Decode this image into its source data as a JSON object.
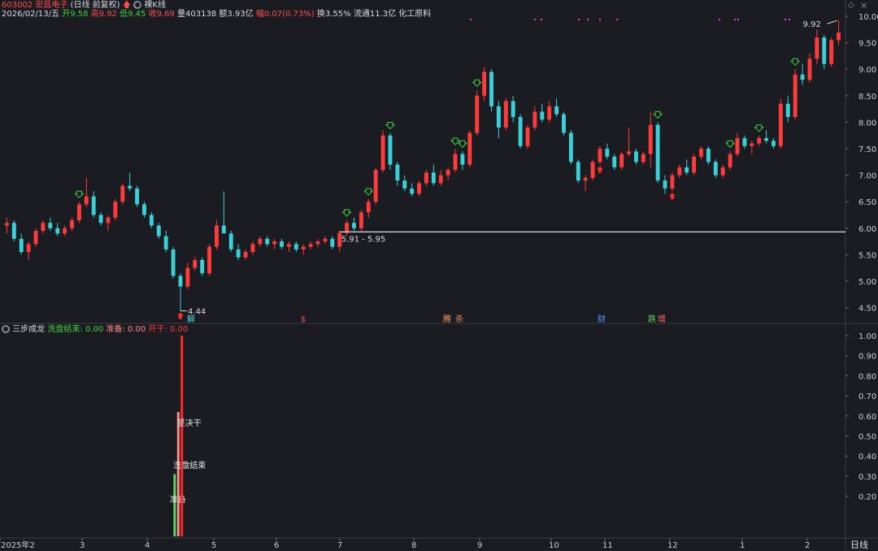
{
  "header": {
    "code": "603002",
    "name": "宏昌电子",
    "mode": "(日线 前复权)",
    "view": "裸K线",
    "date": "2026/02/13/五",
    "open_label": "开",
    "open": "9.58",
    "high_label": "高",
    "high": "9.92",
    "low_label": "低",
    "low": "9.45",
    "close_label": "收",
    "close": "9.69",
    "vol_label": "量",
    "vol": "403138",
    "amt_label": "额",
    "amt": "3.93亿",
    "chg_label": "幅",
    "chg": "0.07(0.73%)",
    "turn": "换3.55%",
    "float": "流通11.3亿",
    "industry": "化工原料"
  },
  "colors": {
    "up": "#ff3b3b",
    "down": "#39d0d8",
    "bg": "#1b1c21",
    "grid": "#2c2e35"
  },
  "chart_data": [
    {
      "type": "candlestick",
      "y_ticks": [
        "10.00",
        "9.50",
        "9.00",
        "8.50",
        "8.00",
        "7.50",
        "7.00",
        "6.50",
        "6.00",
        "5.50",
        "5.00",
        "4.50"
      ],
      "ylim": [
        4.35,
        10.1
      ],
      "x_ticks": [
        "2025年2",
        "3",
        "4",
        "5",
        "6",
        "7",
        "8",
        "9",
        "10",
        "11",
        "12",
        "1",
        "2"
      ],
      "annotations": {
        "low": "4.44",
        "high": "9.92",
        "zone": "5.91 - 5.95",
        "zone_price": 5.93
      },
      "bottom_tags": [
        {
          "text": "解",
          "color": "#52d7df",
          "x": 230
        },
        {
          "text": "$",
          "color": "#ff4d4f",
          "x": 370
        },
        {
          "text": "腾",
          "color": "#ff9a6a",
          "x": 545
        },
        {
          "text": "杀",
          "color": "#ff9a6a",
          "x": 560
        },
        {
          "text": "财",
          "color": "#52a0ff",
          "x": 735
        },
        {
          "text": "跌",
          "color": "#5cd65c",
          "x": 797
        },
        {
          "text": "增",
          "color": "#ff6b6b",
          "x": 809
        }
      ],
      "candles": [
        {
          "o": 6.05,
          "h": 6.2,
          "l": 5.9,
          "c": 6.1
        },
        {
          "o": 6.1,
          "h": 6.15,
          "l": 5.75,
          "c": 5.8
        },
        {
          "o": 5.8,
          "h": 5.9,
          "l": 5.5,
          "c": 5.55
        },
        {
          "o": 5.55,
          "h": 5.75,
          "l": 5.4,
          "c": 5.7
        },
        {
          "o": 5.7,
          "h": 6.0,
          "l": 5.65,
          "c": 5.95
        },
        {
          "o": 5.95,
          "h": 6.15,
          "l": 5.9,
          "c": 6.1
        },
        {
          "o": 6.1,
          "h": 6.2,
          "l": 5.95,
          "c": 6.0
        },
        {
          "o": 6.0,
          "h": 6.1,
          "l": 5.85,
          "c": 5.9
        },
        {
          "o": 5.9,
          "h": 6.05,
          "l": 5.85,
          "c": 6.0
        },
        {
          "o": 6.0,
          "h": 6.2,
          "l": 5.95,
          "c": 6.15
        },
        {
          "o": 6.15,
          "h": 6.5,
          "l": 6.1,
          "c": 6.45
        },
        {
          "o": 6.45,
          "h": 6.95,
          "l": 6.4,
          "c": 6.6
        },
        {
          "o": 6.6,
          "h": 6.7,
          "l": 6.2,
          "c": 6.25
        },
        {
          "o": 6.25,
          "h": 6.3,
          "l": 6.05,
          "c": 6.1
        },
        {
          "o": 6.1,
          "h": 6.25,
          "l": 5.95,
          "c": 6.2
        },
        {
          "o": 6.2,
          "h": 6.55,
          "l": 6.15,
          "c": 6.5
        },
        {
          "o": 6.5,
          "h": 6.85,
          "l": 6.45,
          "c": 6.8
        },
        {
          "o": 6.8,
          "h": 7.05,
          "l": 6.7,
          "c": 6.75
        },
        {
          "o": 6.75,
          "h": 6.8,
          "l": 6.4,
          "c": 6.45
        },
        {
          "o": 6.45,
          "h": 6.5,
          "l": 6.2,
          "c": 6.25
        },
        {
          "o": 6.25,
          "h": 6.3,
          "l": 6.0,
          "c": 6.05
        },
        {
          "o": 6.05,
          "h": 6.1,
          "l": 5.8,
          "c": 5.85
        },
        {
          "o": 5.85,
          "h": 5.95,
          "l": 5.55,
          "c": 5.6
        },
        {
          "o": 5.6,
          "h": 5.65,
          "l": 5.05,
          "c": 5.1
        },
        {
          "o": 5.1,
          "h": 5.15,
          "l": 4.44,
          "c": 4.9
        },
        {
          "o": 4.9,
          "h": 5.35,
          "l": 4.85,
          "c": 5.25
        },
        {
          "o": 5.25,
          "h": 5.45,
          "l": 5.2,
          "c": 5.4
        },
        {
          "o": 5.4,
          "h": 5.45,
          "l": 5.1,
          "c": 5.15
        },
        {
          "o": 5.15,
          "h": 5.7,
          "l": 5.1,
          "c": 5.65
        },
        {
          "o": 5.65,
          "h": 6.15,
          "l": 5.6,
          "c": 6.05
        },
        {
          "o": 6.05,
          "h": 6.7,
          "l": 6.0,
          "c": 5.9
        },
        {
          "o": 5.9,
          "h": 5.95,
          "l": 5.55,
          "c": 5.6
        },
        {
          "o": 5.6,
          "h": 5.7,
          "l": 5.4,
          "c": 5.45
        },
        {
          "o": 5.45,
          "h": 5.6,
          "l": 5.4,
          "c": 5.55
        },
        {
          "o": 5.55,
          "h": 5.75,
          "l": 5.5,
          "c": 5.7
        },
        {
          "o": 5.7,
          "h": 5.85,
          "l": 5.65,
          "c": 5.8
        },
        {
          "o": 5.8,
          "h": 5.85,
          "l": 5.65,
          "c": 5.7
        },
        {
          "o": 5.7,
          "h": 5.8,
          "l": 5.6,
          "c": 5.75
        },
        {
          "o": 5.75,
          "h": 5.8,
          "l": 5.6,
          "c": 5.65
        },
        {
          "o": 5.65,
          "h": 5.75,
          "l": 5.55,
          "c": 5.7
        },
        {
          "o": 5.7,
          "h": 5.75,
          "l": 5.55,
          "c": 5.6
        },
        {
          "o": 5.6,
          "h": 5.7,
          "l": 5.5,
          "c": 5.65
        },
        {
          "o": 5.65,
          "h": 5.75,
          "l": 5.6,
          "c": 5.7
        },
        {
          "o": 5.7,
          "h": 5.8,
          "l": 5.65,
          "c": 5.75
        },
        {
          "o": 5.75,
          "h": 5.85,
          "l": 5.7,
          "c": 5.8
        },
        {
          "o": 5.8,
          "h": 5.85,
          "l": 5.6,
          "c": 5.65
        },
        {
          "o": 5.65,
          "h": 5.95,
          "l": 5.55,
          "c": 5.91
        },
        {
          "o": 5.91,
          "h": 6.15,
          "l": 5.85,
          "c": 6.1
        },
        {
          "o": 6.1,
          "h": 6.2,
          "l": 5.95,
          "c": 6.0
        },
        {
          "o": 6.0,
          "h": 6.35,
          "l": 5.95,
          "c": 6.3
        },
        {
          "o": 6.3,
          "h": 6.55,
          "l": 6.2,
          "c": 6.5
        },
        {
          "o": 6.5,
          "h": 7.15,
          "l": 6.45,
          "c": 7.1
        },
        {
          "o": 7.1,
          "h": 7.85,
          "l": 7.05,
          "c": 7.75
        },
        {
          "o": 7.75,
          "h": 7.8,
          "l": 7.1,
          "c": 7.2
        },
        {
          "o": 7.2,
          "h": 7.25,
          "l": 6.8,
          "c": 6.9
        },
        {
          "o": 6.9,
          "h": 7.0,
          "l": 6.7,
          "c": 6.75
        },
        {
          "o": 6.75,
          "h": 6.85,
          "l": 6.6,
          "c": 6.65
        },
        {
          "o": 6.65,
          "h": 6.9,
          "l": 6.6,
          "c": 6.85
        },
        {
          "o": 6.85,
          "h": 7.1,
          "l": 6.8,
          "c": 7.05
        },
        {
          "o": 7.05,
          "h": 7.2,
          "l": 6.8,
          "c": 6.85
        },
        {
          "o": 6.85,
          "h": 7.1,
          "l": 6.8,
          "c": 7.0
        },
        {
          "o": 7.0,
          "h": 7.15,
          "l": 6.9,
          "c": 7.1
        },
        {
          "o": 7.1,
          "h": 7.5,
          "l": 7.05,
          "c": 7.4
        },
        {
          "o": 7.4,
          "h": 7.45,
          "l": 7.1,
          "c": 7.2
        },
        {
          "o": 7.2,
          "h": 7.85,
          "l": 7.15,
          "c": 7.8
        },
        {
          "o": 7.8,
          "h": 8.6,
          "l": 7.75,
          "c": 8.5
        },
        {
          "o": 8.5,
          "h": 9.05,
          "l": 8.4,
          "c": 8.95
        },
        {
          "o": 8.95,
          "h": 9.0,
          "l": 8.2,
          "c": 8.3
        },
        {
          "o": 8.3,
          "h": 8.4,
          "l": 7.7,
          "c": 7.9
        },
        {
          "o": 7.9,
          "h": 8.45,
          "l": 7.85,
          "c": 8.4
        },
        {
          "o": 8.4,
          "h": 8.5,
          "l": 8.0,
          "c": 8.1
        },
        {
          "o": 8.1,
          "h": 8.15,
          "l": 7.5,
          "c": 7.55
        },
        {
          "o": 7.55,
          "h": 7.95,
          "l": 7.5,
          "c": 7.9
        },
        {
          "o": 7.9,
          "h": 8.3,
          "l": 7.85,
          "c": 8.2
        },
        {
          "o": 8.2,
          "h": 8.35,
          "l": 8.0,
          "c": 8.05
        },
        {
          "o": 8.05,
          "h": 8.4,
          "l": 8.0,
          "c": 8.3
        },
        {
          "o": 8.3,
          "h": 8.45,
          "l": 8.1,
          "c": 8.15
        },
        {
          "o": 8.15,
          "h": 8.2,
          "l": 7.75,
          "c": 7.8
        },
        {
          "o": 7.8,
          "h": 7.85,
          "l": 7.2,
          "c": 7.25
        },
        {
          "o": 7.25,
          "h": 7.3,
          "l": 6.85,
          "c": 6.9
        },
        {
          "o": 6.9,
          "h": 7.0,
          "l": 6.7,
          "c": 6.95
        },
        {
          "o": 6.95,
          "h": 7.3,
          "l": 6.9,
          "c": 7.25
        },
        {
          "o": 7.25,
          "h": 7.55,
          "l": 7.2,
          "c": 7.5
        },
        {
          "o": 7.5,
          "h": 7.6,
          "l": 7.3,
          "c": 7.35
        },
        {
          "o": 7.35,
          "h": 7.4,
          "l": 7.1,
          "c": 7.15
        },
        {
          "o": 7.15,
          "h": 7.45,
          "l": 7.1,
          "c": 7.4
        },
        {
          "o": 7.4,
          "h": 7.9,
          "l": 7.35,
          "c": 7.45
        },
        {
          "o": 7.45,
          "h": 7.5,
          "l": 7.2,
          "c": 7.25
        },
        {
          "o": 7.25,
          "h": 7.45,
          "l": 7.2,
          "c": 7.4
        },
        {
          "o": 7.4,
          "h": 8.2,
          "l": 7.15,
          "c": 7.95
        },
        {
          "o": 7.95,
          "h": 8.0,
          "l": 6.85,
          "c": 6.9
        },
        {
          "o": 6.9,
          "h": 7.0,
          "l": 6.65,
          "c": 6.75
        },
        {
          "o": 6.75,
          "h": 7.05,
          "l": 6.7,
          "c": 7.0
        },
        {
          "o": 7.0,
          "h": 7.2,
          "l": 6.95,
          "c": 7.15
        },
        {
          "o": 7.15,
          "h": 7.3,
          "l": 7.0,
          "c": 7.05
        },
        {
          "o": 7.05,
          "h": 7.4,
          "l": 7.0,
          "c": 7.35
        },
        {
          "o": 7.35,
          "h": 7.55,
          "l": 7.3,
          "c": 7.5
        },
        {
          "o": 7.5,
          "h": 7.55,
          "l": 7.2,
          "c": 7.25
        },
        {
          "o": 7.25,
          "h": 7.3,
          "l": 6.95,
          "c": 7.0
        },
        {
          "o": 7.0,
          "h": 7.2,
          "l": 6.95,
          "c": 7.15
        },
        {
          "o": 7.15,
          "h": 7.45,
          "l": 7.1,
          "c": 7.4
        },
        {
          "o": 7.4,
          "h": 7.8,
          "l": 7.35,
          "c": 7.7
        },
        {
          "o": 7.7,
          "h": 7.75,
          "l": 7.5,
          "c": 7.55
        },
        {
          "o": 7.55,
          "h": 7.65,
          "l": 7.4,
          "c": 7.6
        },
        {
          "o": 7.6,
          "h": 7.75,
          "l": 7.55,
          "c": 7.7
        },
        {
          "o": 7.7,
          "h": 7.85,
          "l": 7.6,
          "c": 7.65
        },
        {
          "o": 7.65,
          "h": 7.7,
          "l": 7.5,
          "c": 7.55
        },
        {
          "o": 7.55,
          "h": 8.45,
          "l": 7.5,
          "c": 8.35
        },
        {
          "o": 8.35,
          "h": 8.5,
          "l": 8.0,
          "c": 8.1
        },
        {
          "o": 8.1,
          "h": 9.0,
          "l": 8.05,
          "c": 8.9
        },
        {
          "o": 8.9,
          "h": 9.1,
          "l": 8.7,
          "c": 8.8
        },
        {
          "o": 8.8,
          "h": 9.3,
          "l": 8.75,
          "c": 9.2
        },
        {
          "o": 9.2,
          "h": 9.75,
          "l": 9.1,
          "c": 9.6
        },
        {
          "o": 9.6,
          "h": 9.65,
          "l": 9.0,
          "c": 9.1
        },
        {
          "o": 9.1,
          "h": 9.6,
          "l": 9.05,
          "c": 9.55
        },
        {
          "o": 9.55,
          "h": 9.92,
          "l": 9.45,
          "c": 9.69
        }
      ]
    },
    {
      "type": "bar",
      "title": "三步成龙",
      "legend": [
        {
          "name": "洗盘结束",
          "value": "0.00",
          "color": "#3cd23c"
        },
        {
          "name": "准备",
          "value": "0.00",
          "color": "#ff8c8c"
        },
        {
          "name": "开干",
          "value": "0.00",
          "color": "#ff3b3b"
        }
      ],
      "y_ticks": [
        "1.00",
        "0.90",
        "0.80",
        "0.70",
        "0.60",
        "0.50",
        "0.40",
        "0.30",
        "0.20"
      ],
      "ylim": [
        0,
        1.05
      ],
      "bars": [
        {
          "label": "准备",
          "value": 0.31,
          "color": "#5fd35f",
          "bar_index": 23.2
        },
        {
          "label": "洗盘结束",
          "value": 0.62,
          "color": "#ff8c8c",
          "bar_index": 23.7
        },
        {
          "label": "坚决干",
          "value": 1.0,
          "color": "#ff2b2b",
          "bar_index": 24.2
        }
      ]
    }
  ],
  "footer": {
    "period": "日线"
  }
}
